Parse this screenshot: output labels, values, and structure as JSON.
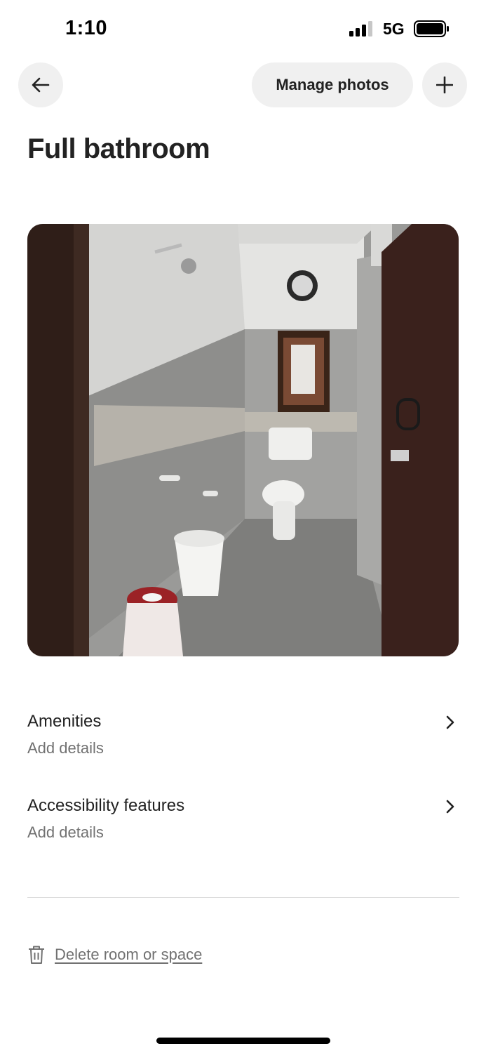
{
  "status_bar": {
    "time": "1:10",
    "network": "5G",
    "signal_icon": "signal-bars-icon",
    "battery_icon": "battery-icon"
  },
  "nav": {
    "back_icon": "arrow-left-icon",
    "manage_photos_label": "Manage photos",
    "add_icon": "plus-icon"
  },
  "page": {
    "title": "Full bathroom"
  },
  "photo": {
    "subject": "bathroom-photo"
  },
  "sections": [
    {
      "title": "Amenities",
      "subtitle": "Add details",
      "icon": "chevron-right-icon"
    },
    {
      "title": "Accessibility features",
      "subtitle": "Add details",
      "icon": "chevron-right-icon"
    }
  ],
  "delete": {
    "label": "Delete room or space",
    "icon": "trash-icon"
  },
  "colors": {
    "text_primary": "#222222",
    "text_secondary": "#717171",
    "button_bg": "#f0f0f0",
    "divider": "#dddddd"
  }
}
